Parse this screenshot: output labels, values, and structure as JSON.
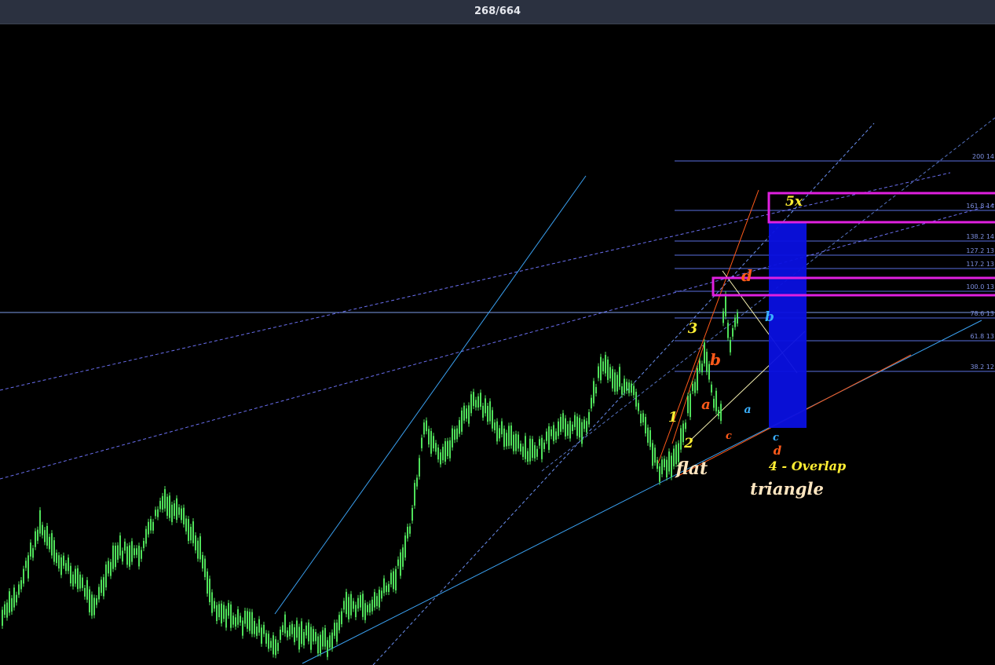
{
  "header": {
    "counter": "268/664"
  },
  "colors": {
    "background": "#000000",
    "candles": "#4fe05a",
    "fib_lines": "#5a6fe0",
    "trend_lines": "#3aa0f0",
    "target_box": "#e020e0",
    "projection_box": "#0a10e0",
    "orange": "#ff5a1a",
    "yellow": "#ffee33",
    "blue_label": "#3ab0ff",
    "cream": "#ffe6c0"
  },
  "chart_data": {
    "type": "candlestick",
    "fib_levels": [
      {
        "label": "200 14",
        "level": "200"
      },
      {
        "label": "161.8 14",
        "level": "161.8"
      },
      {
        "label": "138.2 14",
        "level": "138.2"
      },
      {
        "label": "127.2 13",
        "level": "127.2"
      },
      {
        "label": "117.2 13",
        "level": "117.2"
      },
      {
        "label": "100.0   13",
        "level": "100.0"
      },
      {
        "label": "78.6 13",
        "level": "78.6"
      },
      {
        "label": "61.8 13",
        "level": "61.8"
      },
      {
        "label": "38.2 12",
        "level": "38.2"
      }
    ],
    "wave_labels": [
      {
        "text": "1",
        "color": "yellow"
      },
      {
        "text": "2",
        "color": "yellow"
      },
      {
        "text": "3",
        "color": "yellow"
      },
      {
        "text": "a",
        "color": "orange"
      },
      {
        "text": "b",
        "color": "orange"
      },
      {
        "text": "c",
        "color": "orange"
      },
      {
        "text": "d",
        "color": "orange"
      },
      {
        "text": "d",
        "color": "orange"
      },
      {
        "text": "a",
        "color": "blue_label"
      },
      {
        "text": "b",
        "color": "blue_label"
      },
      {
        "text": "c",
        "color": "blue_label"
      },
      {
        "text": "5x",
        "color": "yellow"
      }
    ],
    "annotations": [
      {
        "text": "flat",
        "color": "cream"
      },
      {
        "text": "triangle",
        "color": "cream"
      },
      {
        "text": "4 - Overlap",
        "color": "yellow"
      }
    ]
  }
}
